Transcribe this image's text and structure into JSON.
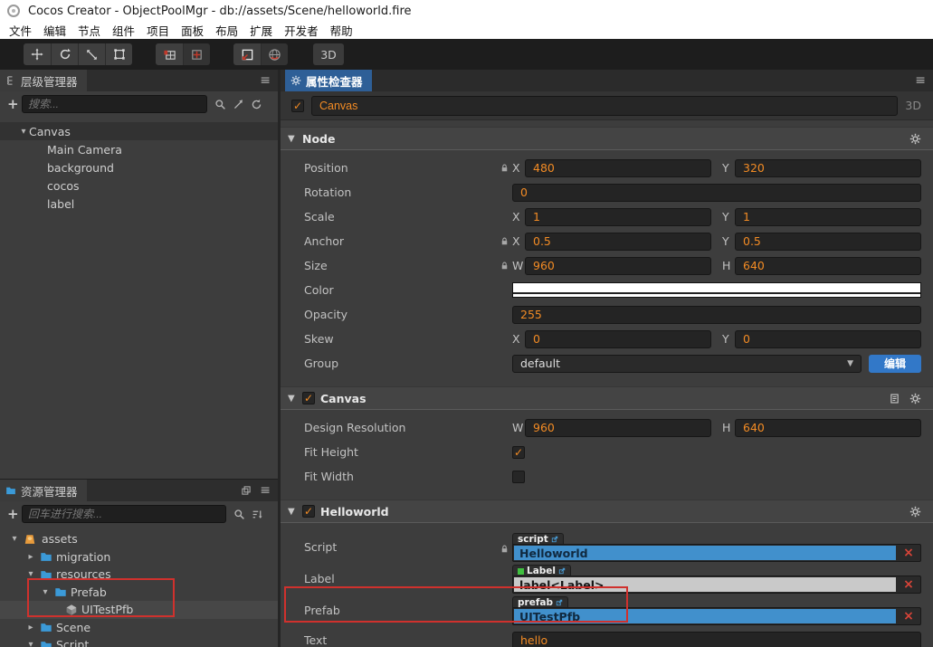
{
  "colors": {
    "accent_orange": "#F28B24",
    "active_tab_blue": "#2E5F97",
    "component_bar_blue": "#4190CC",
    "component_bar_light": "#C9C9C9",
    "edit_button_blue": "#3278C8",
    "annotation_red": "#D0312D",
    "remove_x_red": "#D94438",
    "folder_blue": "#3B9AD8",
    "assets_root_orange": "#E89B3C",
    "color_property_value": "#FFFFFF"
  },
  "icons": {
    "check": "✓",
    "arrow_down": "▾",
    "arrow_right": "▸",
    "dropdown_caret": "▼",
    "hamburger": "≡",
    "close_x": "×",
    "plus": "+"
  },
  "title_bar": {
    "app_title": "Cocos Creator - ObjectPoolMgr - db://assets/Scene/helloworld.fire"
  },
  "menu_bar": {
    "items": [
      "文件",
      "编辑",
      "节点",
      "组件",
      "项目",
      "面板",
      "布局",
      "扩展",
      "开发者",
      "帮助"
    ]
  },
  "toolbar": {
    "mode_button_label": "3D"
  },
  "hierarchy": {
    "tab_label": "层级管理器",
    "search_placeholder": "搜索...",
    "root": {
      "label": "Canvas",
      "children": [
        "Main Camera",
        "background",
        "cocos",
        "label"
      ]
    }
  },
  "assets": {
    "tab_label": "资源管理器",
    "search_placeholder": "回车进行搜索...",
    "tree": [
      {
        "label": "assets"
      },
      {
        "label": "migration"
      },
      {
        "label": "resources"
      },
      {
        "label": "Prefab"
      },
      {
        "label": "UITestPfb"
      },
      {
        "label": "Scene"
      },
      {
        "label": "Script"
      }
    ]
  },
  "inspector": {
    "tab_label": "属性检查器",
    "name_row": {
      "checked": true,
      "value": "Canvas",
      "mode_label": "3D"
    },
    "axis": {
      "x": "X",
      "y": "Y",
      "w": "W",
      "h": "H"
    },
    "node": {
      "title": "Node",
      "position": {
        "label": "Position",
        "locked": true,
        "x": "480",
        "y": "320"
      },
      "rotation": {
        "label": "Rotation",
        "value": "0"
      },
      "scale": {
        "label": "Scale",
        "x": "1",
        "y": "1"
      },
      "anchor": {
        "label": "Anchor",
        "locked": true,
        "x": "0.5",
        "y": "0.5"
      },
      "size": {
        "label": "Size",
        "locked": true,
        "w": "960",
        "h": "640"
      },
      "color": {
        "label": "Color",
        "value": "#FFFFFF"
      },
      "opacity": {
        "label": "Opacity",
        "value": "255"
      },
      "skew": {
        "label": "Skew",
        "x": "0",
        "y": "0"
      },
      "group": {
        "label": "Group",
        "value": "default",
        "edit_button": "编辑"
      }
    },
    "canvas": {
      "title": "Canvas",
      "checked": true,
      "design_resolution": {
        "label": "Design Resolution",
        "w": "960",
        "h": "640"
      },
      "fit_height": {
        "label": "Fit Height",
        "checked": true
      },
      "fit_width": {
        "label": "Fit Width",
        "checked": false
      }
    },
    "helloworld": {
      "title": "Helloworld",
      "checked": true,
      "script": {
        "label": "Script",
        "tag": "script",
        "value": "Helloworld",
        "locked": true
      },
      "label_prop": {
        "label": "Label",
        "tag": "Label",
        "value": "label<Label>"
      },
      "prefab": {
        "label": "Prefab",
        "tag": "prefab",
        "value": "UITestPfb",
        "annotated": true
      },
      "text": {
        "label": "Text",
        "value": "hello"
      }
    }
  }
}
